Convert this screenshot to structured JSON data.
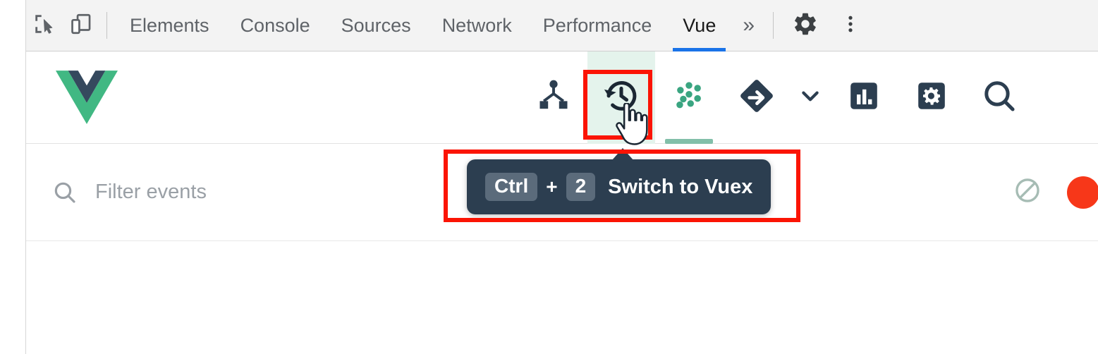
{
  "devtools": {
    "left_icons": [
      {
        "name": "inspect-element-icon",
        "label": "Inspect element"
      },
      {
        "name": "device-toolbar-icon",
        "label": "Toggle device toolbar"
      }
    ],
    "tabs": [
      {
        "label": "Elements",
        "active": false
      },
      {
        "label": "Console",
        "active": false
      },
      {
        "label": "Sources",
        "active": false
      },
      {
        "label": "Network",
        "active": false
      },
      {
        "label": "Performance",
        "active": false
      },
      {
        "label": "Vue",
        "active": true
      }
    ],
    "overflow_label": "»",
    "settings_icon": "gear-icon",
    "more_menu_icon": "kebab-menu-icon",
    "active_tab_underline_color": "#1a73e8"
  },
  "vue_toolbar": {
    "logo": "vue-logo",
    "logo_colors": {
      "outer": "#41b883",
      "inner": "#35495e"
    },
    "items": [
      {
        "name": "components-tab",
        "icon": "component-tree-icon",
        "label": "Components",
        "state": "default"
      },
      {
        "name": "timeline-tab",
        "icon": "history-clock-icon",
        "label": "Timeline",
        "state": "hovered"
      },
      {
        "name": "vuex-tab",
        "icon": "vuex-dots-icon",
        "label": "Vuex",
        "state": "active"
      },
      {
        "name": "router-tab",
        "icon": "router-diamond-arrow-icon",
        "label": "Routing",
        "state": "default"
      },
      {
        "name": "router-dropdown",
        "icon": "chevron-down-icon",
        "label": "Routing options",
        "state": "default"
      },
      {
        "name": "performance-tab",
        "icon": "bar-chart-icon",
        "label": "Performance",
        "state": "default"
      },
      {
        "name": "settings-tab",
        "icon": "gear-square-icon",
        "label": "Settings",
        "state": "default"
      },
      {
        "name": "search-tab",
        "icon": "circle-search-icon",
        "label": "Search",
        "state": "default"
      }
    ],
    "active_underline_color": "#82bfa9",
    "hover_background_color": "#e4f3ec"
  },
  "events_bar": {
    "search_icon": "search-icon",
    "filter_placeholder": "Filter events",
    "filter_value": "",
    "clear_icon": "clear-prohibited-icon",
    "record_icon": "record-dot-icon",
    "record_color": "#f73719"
  },
  "tooltip": {
    "keys": [
      "Ctrl",
      "2"
    ],
    "separator": "+",
    "label": "Switch to Vuex",
    "background_color": "#2c3e50",
    "key_background_color": "#5b6b7b"
  },
  "annotations": {
    "box_color": "#fb1404",
    "targets": [
      "timeline-tab-button",
      "shortcut-tooltip"
    ]
  },
  "cursor": {
    "type": "pointing-hand-cursor"
  }
}
